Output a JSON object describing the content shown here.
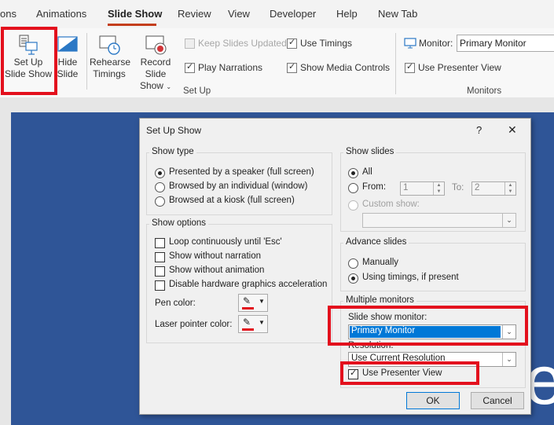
{
  "ribbon_tabs": [
    {
      "label": "ons"
    },
    {
      "label": "Animations"
    },
    {
      "label": "Slide Show",
      "active": true
    },
    {
      "label": "Review"
    },
    {
      "label": "View"
    },
    {
      "label": "Developer"
    },
    {
      "label": "Help"
    },
    {
      "label": "New Tab"
    }
  ],
  "ribbon": {
    "setup_button": {
      "line1": "Set Up",
      "line2": "Slide Show"
    },
    "hide_button": {
      "line1": "Hide",
      "line2": "Slide"
    },
    "rehearse_button": {
      "line1": "Rehearse",
      "line2": "Timings"
    },
    "record_button": {
      "line1": "Record Slide",
      "line2": "Show"
    },
    "keep_slides_updated": {
      "label": "Keep Slides Updated",
      "checked": false,
      "disabled": true
    },
    "use_timings": {
      "label": "Use Timings",
      "checked": true
    },
    "play_narrations": {
      "label": "Play Narrations",
      "checked": true
    },
    "show_media_controls": {
      "label": "Show Media Controls",
      "checked": true
    },
    "setup_group_label": "Set Up",
    "monitor_label": "Monitor:",
    "monitor_value": "Primary Monitor",
    "use_presenter_view": {
      "label": "Use Presenter View",
      "checked": true
    },
    "monitors_group_label": "Monitors"
  },
  "slide_text_fragment": "e",
  "dialog": {
    "title": "Set Up Show",
    "help": "?",
    "close": "✕",
    "show_type": {
      "legend": "Show type",
      "options": [
        {
          "label": "Presented by a speaker (full screen)",
          "selected": true
        },
        {
          "label": "Browsed by an individual (window)",
          "selected": false
        },
        {
          "label": "Browsed at a kiosk (full screen)",
          "selected": false
        }
      ]
    },
    "show_options": {
      "legend": "Show options",
      "checkboxes": [
        {
          "label": "Loop continuously until 'Esc'",
          "checked": false
        },
        {
          "label": "Show without narration",
          "checked": false
        },
        {
          "label": "Show without animation",
          "checked": false
        },
        {
          "label": "Disable hardware graphics acceleration",
          "checked": false
        }
      ],
      "pen_color_label": "Pen color:",
      "laser_color_label": "Laser pointer color:",
      "pen_color": "#e3101d",
      "laser_color": "#e3101d"
    },
    "show_slides": {
      "legend": "Show slides",
      "all_label": "All",
      "from_label": "From:",
      "from_value": "1",
      "to_label": "To:",
      "to_value": "2",
      "custom_label": "Custom show:",
      "selected": "All"
    },
    "advance_slides": {
      "legend": "Advance slides",
      "options": [
        {
          "label": "Manually",
          "selected": false
        },
        {
          "label": "Using timings, if present",
          "selected": true
        }
      ]
    },
    "multiple_monitors": {
      "legend": "Multiple monitors",
      "monitor_label": "Slide show monitor:",
      "monitor_value": "Primary Monitor",
      "resolution_label": "Resolution:",
      "resolution_value": "Use Current Resolution",
      "presenter_view_label": "Use Presenter View",
      "presenter_view_checked": true
    },
    "ok": "OK",
    "cancel": "Cancel"
  },
  "colors": {
    "highlight": "#e3101d",
    "slide_bg": "#2f5597",
    "selection": "#0078d7",
    "active_tab": "#c43e1c"
  }
}
